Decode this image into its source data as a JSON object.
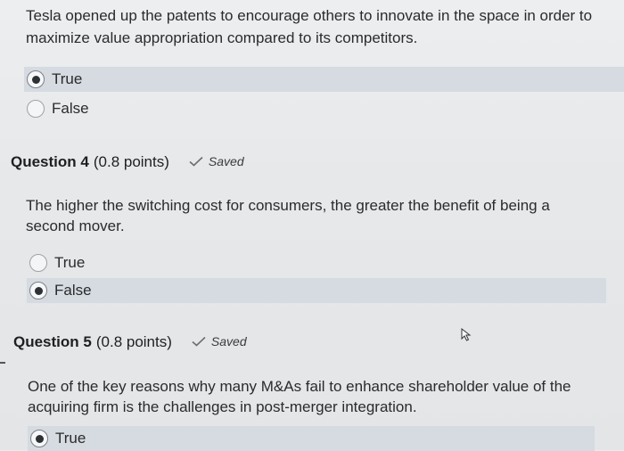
{
  "q3": {
    "text": "Tesla opened up the patents to encourage others to innovate in the space in order to maximize value appropriation compared to its competitors.",
    "options": [
      {
        "label": "True",
        "selected": true
      },
      {
        "label": "False",
        "selected": false
      }
    ]
  },
  "q4": {
    "title": "Question 4",
    "points": "(0.8 points)",
    "saved": "Saved",
    "text": "The higher the switching cost for consumers, the greater the benefit of being a second mover.",
    "options": [
      {
        "label": "True",
        "selected": false
      },
      {
        "label": "False",
        "selected": true
      }
    ]
  },
  "q5": {
    "title": "Question 5",
    "points": "(0.8 points)",
    "saved": "Saved",
    "text": "One of the key reasons why many M&As fail to enhance shareholder value of the acquiring firm is the challenges in post-merger integration.",
    "options": [
      {
        "label": "True",
        "selected": true
      }
    ]
  },
  "icons": {
    "check": "check-icon",
    "cursor": "mouse-cursor-icon"
  },
  "colors": {
    "selected_row_bg": "#d5dbe1",
    "page_bg": "#e9eaec"
  }
}
